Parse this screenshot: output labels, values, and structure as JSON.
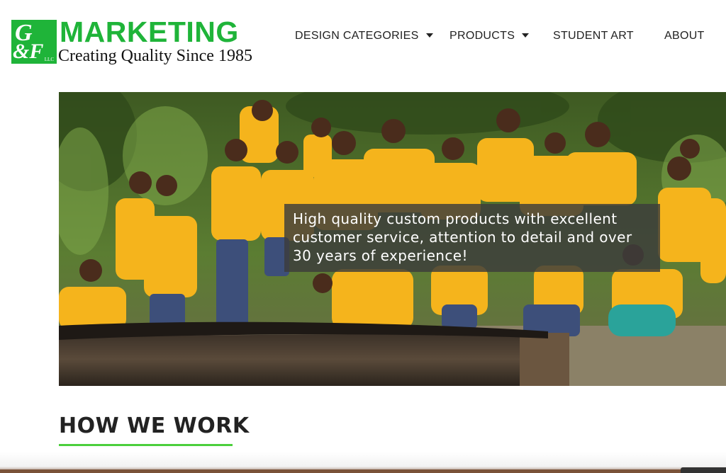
{
  "brand": {
    "badge_letters": "G",
    "badge_amp": "&F",
    "badge_llc": "LLC",
    "name": "MARKETING",
    "tagline": "Creating Quality Since 1985",
    "color": "#1fb439"
  },
  "nav": {
    "items": [
      {
        "label": "DESIGN CATEGORIES",
        "has_dropdown": true
      },
      {
        "label": "PRODUCTS",
        "has_dropdown": true
      },
      {
        "label": "STUDENT ART",
        "has_dropdown": false
      },
      {
        "label": "ABOUT",
        "has_dropdown": false
      }
    ]
  },
  "hero": {
    "caption": "High quality custom products with excellent customer service, attention to detail and over 30 years of experience!",
    "shirt_color": "#f5b41c"
  },
  "section": {
    "title": "HOW WE WORK",
    "underline_color": "#4ccf3c"
  }
}
